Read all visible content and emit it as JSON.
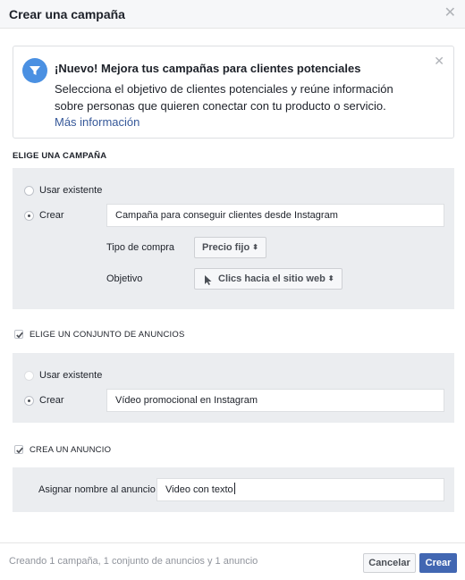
{
  "dialog": {
    "title": "Crear una campaña",
    "close_icon": "close-icon"
  },
  "notice": {
    "icon": "filter-icon",
    "title": "¡Nuevo! Mejora tus campañas para clientes potenciales",
    "body": "Selecciona el objetivo de clientes potenciales y reúne información sobre personas que quieren conectar con tu producto o servicio.",
    "link": "Más información",
    "icon_color": "#4a90e2"
  },
  "campaign": {
    "section_label": "ELIGE UNA CAMPAÑA",
    "use_existing_label": "Usar existente",
    "create_label": "Crear",
    "selected": "Crear",
    "name_value": "Campaña para conseguir clientes desde Instagram",
    "buy_type_label": "Tipo de compra",
    "buy_type_value": "Precio fijo",
    "objective_label": "Objetivo",
    "objective_value": "Clics hacia el sitio web",
    "objective_icon": "cursor-icon"
  },
  "ad_set": {
    "section_label": "ELIGE UN CONJUNTO DE ANUNCIOS",
    "checked": true,
    "use_existing_label": "Usar existente",
    "create_label": "Crear",
    "selected": "Crear",
    "name_value": "Vídeo promocional en Instagram"
  },
  "ad": {
    "section_label": "CREA UN ANUNCIO",
    "checked": true,
    "name_label": "Asignar nombre al anuncio",
    "name_value": "Video con texto"
  },
  "footer": {
    "summary": "Creando 1 campaña, 1 conjunto de anuncios y 1 anuncio",
    "cancel_label": "Cancelar",
    "create_label": "Crear"
  },
  "colors": {
    "primary_button": "#4267b2",
    "link": "#365899",
    "panel_bg": "#ebedf0"
  }
}
